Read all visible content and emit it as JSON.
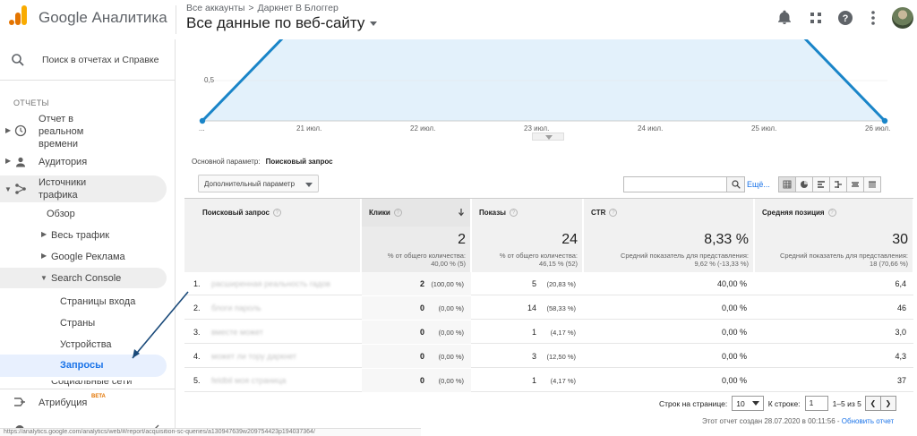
{
  "app": {
    "name": "Google Аналитика"
  },
  "header": {
    "breadcrumb": [
      "Все аккаунты",
      ">",
      "Даркнет В Блоггер"
    ],
    "view_title": "Все данные по веб-сайту"
  },
  "sidebar": {
    "search_label": "Поиск в отчетах и Справке",
    "section_reports": "ОТЧЕТЫ",
    "items": {
      "realtime": "Отчет в реальном времени",
      "audience": "Аудитория",
      "acquisition": "Источники трафика",
      "overview": "Обзор",
      "all_traffic": "Весь трафик",
      "google_ads": "Google Реклама",
      "search_console": "Search Console",
      "landing_pages": "Страницы входа",
      "countries": "Страны",
      "devices": "Устройства",
      "queries": "Запросы",
      "social": "Социальные сети",
      "attribution": "Атрибуция",
      "attribution_badge": "BETA"
    }
  },
  "chart": {
    "y_label": "0,5",
    "x_ticks": [
      "...",
      "21 июл.",
      "22 июл.",
      "23 июл.",
      "24 июл.",
      "25 июл.",
      "26 июл."
    ],
    "line_color": "#1a85c8",
    "fill_color": "#e3f1fb"
  },
  "chart_data": {
    "type": "area",
    "x": [
      "...",
      "21 июл.",
      "22 июл.",
      "23 июл.",
      "24 июл.",
      "25 июл.",
      "26 июл."
    ],
    "series": [
      {
        "values": [
          0,
          1,
          1,
          1,
          1,
          1,
          0
        ]
      }
    ]
  },
  "controls": {
    "primary_param_label": "Основной параметр:",
    "primary_param_value": "Поисковый запрос",
    "secondary_param": "Дополнительный параметр",
    "more_link": "Ещё..."
  },
  "table": {
    "headers": {
      "query": "Поисковый запрос",
      "clicks": "Клики",
      "impressions": "Показы",
      "ctr": "CTR",
      "position": "Средняя позиция"
    },
    "totals": {
      "clicks": "2",
      "clicks_sub1": "% от общего количества:",
      "clicks_sub2": "40,00 % (5)",
      "impressions": "24",
      "impressions_sub1": "% от общего количества:",
      "impressions_sub2": "46,15 % (52)",
      "ctr": "8,33 %",
      "ctr_sub1": "Средний показатель для представления:",
      "ctr_sub2": "9,62 % (-13,33 %)",
      "position": "30",
      "position_sub1": "Средний показатель для представления:",
      "position_sub2": "18 (70,66 %)"
    },
    "rows": [
      {
        "num": "1.",
        "query": "расширенная реальность гадов",
        "clicks": "2",
        "clicks_pct": "(100,00 %)",
        "impressions": "5",
        "impressions_pct": "(20,83 %)",
        "ctr": "40,00 %",
        "position": "6,4"
      },
      {
        "num": "2.",
        "query": "блоги пароль",
        "clicks": "0",
        "clicks_pct": "(0,00 %)",
        "impressions": "14",
        "impressions_pct": "(58,33 %)",
        "ctr": "0,00 %",
        "position": "46"
      },
      {
        "num": "3.",
        "query": "вместе может",
        "clicks": "0",
        "clicks_pct": "(0,00 %)",
        "impressions": "1",
        "impressions_pct": "(4,17 %)",
        "ctr": "0,00 %",
        "position": "3,0"
      },
      {
        "num": "4.",
        "query": "может ли тору даркнет",
        "clicks": "0",
        "clicks_pct": "(0,00 %)",
        "impressions": "3",
        "impressions_pct": "(12,50 %)",
        "ctr": "0,00 %",
        "position": "4,3"
      },
      {
        "num": "5.",
        "query": "feldbil моя страница",
        "clicks": "0",
        "clicks_pct": "(0,00 %)",
        "impressions": "1",
        "impressions_pct": "(4,17 %)",
        "ctr": "0,00 %",
        "position": "37"
      }
    ]
  },
  "pagination": {
    "rows_label": "Строк на странице:",
    "rows_value": "10",
    "goto_label": "К строке:",
    "goto_value": "1",
    "range": "1–5 из 5"
  },
  "report_ts": "Этот отчет создан 28.07.2020 в 00:11:56 -",
  "refresh_link": "Обновить отчет",
  "statusbar_url": "https://analytics.google.com/analytics/web/#/report/acquisition-sc-queries/a130947639w209754423p194037364/"
}
